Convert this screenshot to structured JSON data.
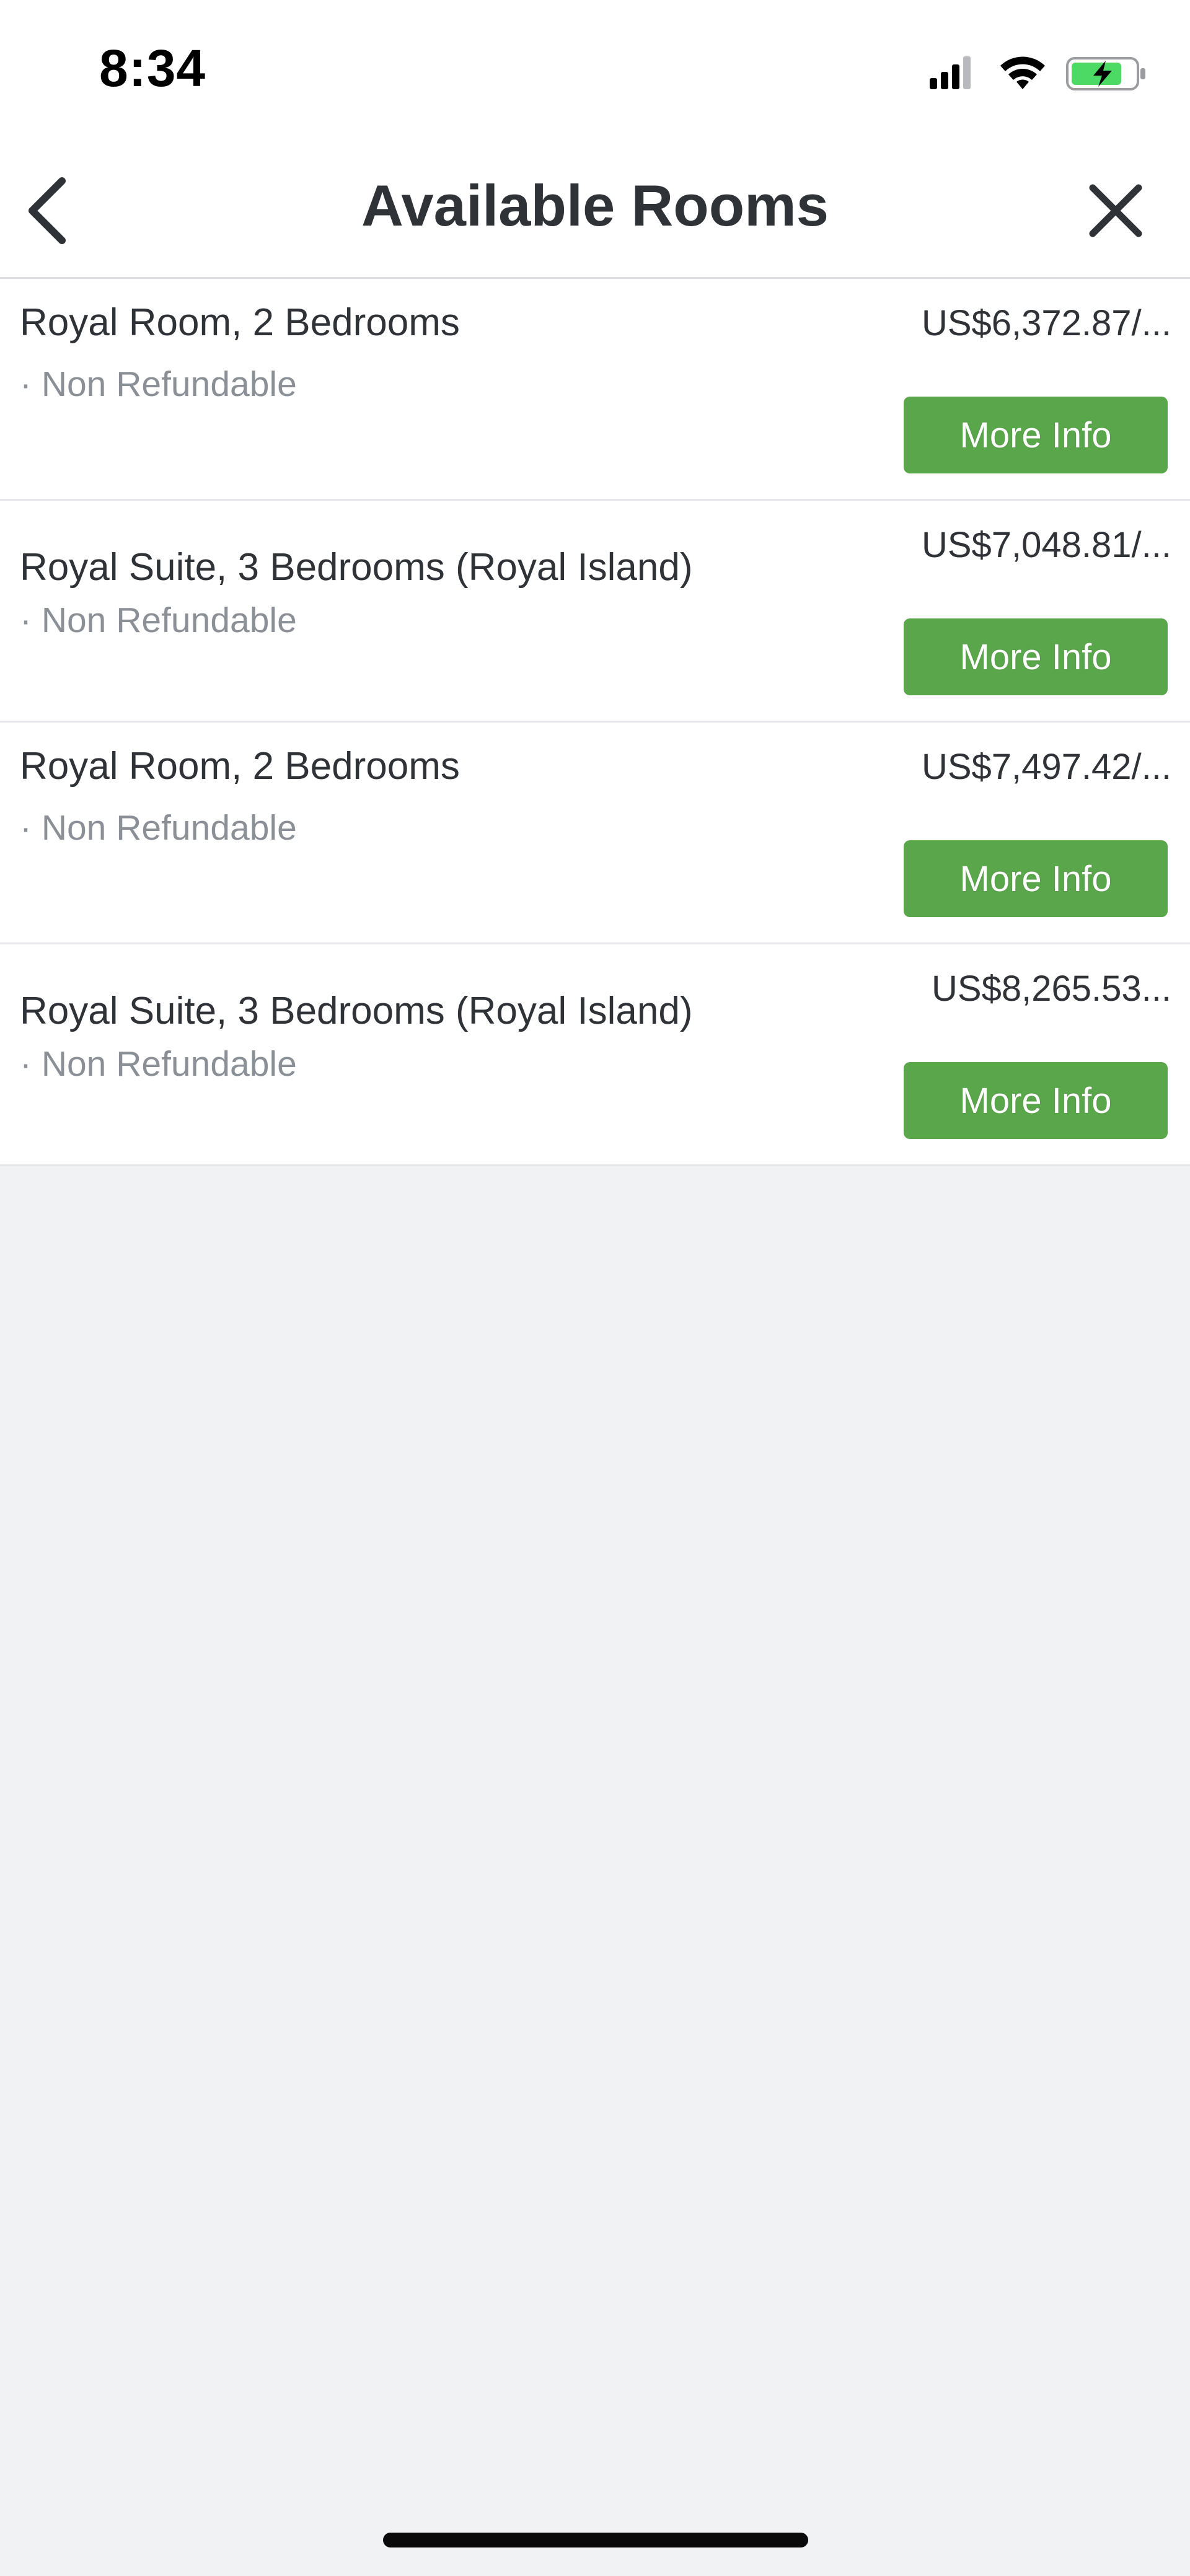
{
  "status_bar": {
    "time": "8:34",
    "icons": [
      "cellular-signal-icon",
      "wifi-icon",
      "battery-charging-icon"
    ]
  },
  "nav": {
    "title": "Available Rooms",
    "back_icon": "chevron-left-icon",
    "close_icon": "close-icon"
  },
  "rooms": [
    {
      "name": "Royal Room, 2 Bedrooms",
      "policy": "· Non Refundable",
      "price": "US$6,372.87/...",
      "button_label": "More Info"
    },
    {
      "name": "Royal Suite, 3 Bedrooms (Royal Island)",
      "policy": "· Non Refundable",
      "price": "US$7,048.81/...",
      "button_label": "More Info"
    },
    {
      "name": "Royal Room, 2 Bedrooms",
      "policy": "· Non Refundable",
      "price": "US$7,497.42/...",
      "button_label": "More Info"
    },
    {
      "name": "Royal Suite, 3 Bedrooms (Royal Island)",
      "policy": "· Non Refundable",
      "price": "US$8,265.53...",
      "button_label": "More Info"
    }
  ],
  "colors": {
    "accent_button": "#5aa64b",
    "background": "#f1f2f4",
    "text_primary": "#2f3338",
    "text_secondary": "#8b9097",
    "battery_fill": "#4cd964"
  }
}
